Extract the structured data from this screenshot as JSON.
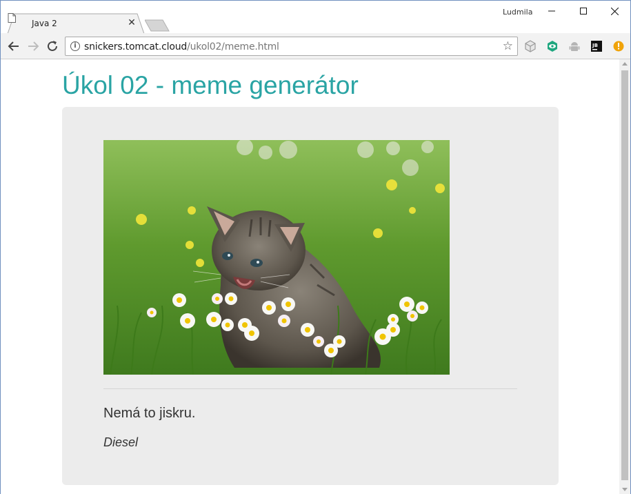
{
  "browser": {
    "tab": {
      "title": "Java 2",
      "close_icon": "close-icon",
      "page_icon": "document-icon"
    },
    "user_label": "Ludmila",
    "window_controls": {
      "minimize": "–",
      "maximize": "☐",
      "close": "✕"
    },
    "toolbar": {
      "back_icon": "back-arrow-icon",
      "forward_icon": "forward-arrow-icon",
      "reload_icon": "reload-icon",
      "url_host": "snickers.tomcat.cloud",
      "url_path": "/ukol02/meme.html",
      "bookmark_icon": "star-icon",
      "extensions": [
        "cube-extension-icon",
        "eye-extension-icon",
        "android-extension-icon",
        "jetbrains-extension-icon",
        "warning-extension-icon"
      ],
      "jb_label": "JB"
    }
  },
  "page": {
    "title": "Úkol 02 - meme generátor",
    "image": {
      "subject": "kitten in grass with daisies"
    },
    "caption": "Nemá to jiskru.",
    "author": "Diesel"
  },
  "colors": {
    "title": "#2aa4a4",
    "card": "#ececec",
    "text": "#333333"
  }
}
